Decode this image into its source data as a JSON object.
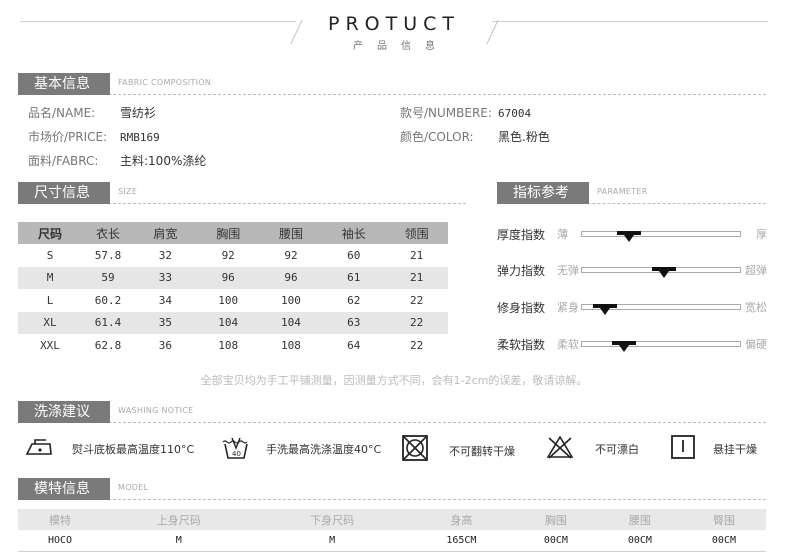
{
  "header": {
    "title": "PROTUCT",
    "subtitle": "产品信息"
  },
  "basic_info": {
    "title": "基本信息",
    "subtitle": "FABRIC COMPOSITION",
    "fields": [
      {
        "label": "品名/NAME:",
        "value": "雪纺衫"
      },
      {
        "label": "款号/NUMBERE:",
        "value": "67004"
      },
      {
        "label": "市场价/PRICE:",
        "value": "RMB169"
      },
      {
        "label": "颜色/COLOR:",
        "value": "黑色.粉色"
      },
      {
        "label": "面料/FABRC:",
        "value": "主料:100%涤纶"
      }
    ]
  },
  "size_info": {
    "title": "尺寸信息",
    "subtitle": "SIZE",
    "columns": [
      "尺码",
      "衣长",
      "肩宽",
      "胸围",
      "腰围",
      "袖长",
      "领围"
    ],
    "rows": [
      [
        "S",
        "57.8",
        "32",
        "92",
        "92",
        "60",
        "21"
      ],
      [
        "M",
        "59",
        "33",
        "96",
        "96",
        "61",
        "21"
      ],
      [
        "L",
        "60.2",
        "34",
        "100",
        "100",
        "62",
        "22"
      ],
      [
        "XL",
        "61.4",
        "35",
        "104",
        "104",
        "63",
        "22"
      ],
      [
        "XXL",
        "62.8",
        "36",
        "108",
        "108",
        "64",
        "22"
      ]
    ]
  },
  "params": {
    "title": "指标参考",
    "subtitle": "PARAMETER",
    "items": [
      {
        "name": "厚度指数",
        "low": "薄",
        "high": "厚",
        "level": 0.3
      },
      {
        "name": "弹力指数",
        "low": "无弹",
        "high": "超弹",
        "level": 0.52
      },
      {
        "name": "修身指数",
        "low": "紧身",
        "high": "宽松",
        "level": 0.15
      },
      {
        "name": "柔软指数",
        "low": "柔软",
        "high": "偏硬",
        "level": 0.27
      }
    ]
  },
  "note": "全部宝贝均为手工平铺测量，因测量方式不同，会有1-2cm的误差，敬请谅解。",
  "washing": {
    "title": "洗涤建议",
    "subtitle": "WASHING NOTICE",
    "items": [
      {
        "icon": "iron-icon",
        "text": "熨斗底板最高温度110°C"
      },
      {
        "icon": "hand-wash-icon",
        "text": "手洗最高洗涤温度40°C"
      },
      {
        "icon": "no-tumble-dry-icon",
        "text": "不可翻转干燥"
      },
      {
        "icon": "no-bleach-icon",
        "text": "不可漂白"
      },
      {
        "icon": "hang-dry-icon",
        "text": "悬挂干燥"
      }
    ]
  },
  "model": {
    "title": "模特信息",
    "subtitle": "MODEL",
    "columns": [
      "模特",
      "上身尺码",
      "下身尺码",
      "身高",
      "胸围",
      "腰围",
      "臀围"
    ],
    "row": [
      "HOCO",
      "M",
      "M",
      "165CM",
      "00CM",
      "00CM",
      "00CM"
    ]
  }
}
